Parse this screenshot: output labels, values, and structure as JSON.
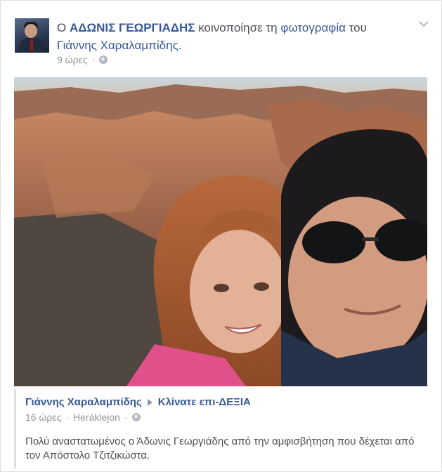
{
  "post": {
    "prefix": "Ο",
    "author": "ΑΔΩΝΙΣ ΓΕΩΡΓΙΑΔΗΣ",
    "action": "κοινοποίησε τη",
    "object": "φωτογραφία",
    "connector": "του",
    "owner": "Γιάννης Χαραλαμπίδης",
    "owner_suffix": ".",
    "time": "9 ώρες",
    "separator": "·",
    "privacy_icon": "globe-icon",
    "menu_icon": "chevron-down-icon"
  },
  "shared": {
    "author": "Γιάννης Χαραλαμπίδης",
    "arrow_icon": "triangle-right-icon",
    "target": "Κλίνατε επι-ΔΕΞΙΑ",
    "time": "16 ώρες",
    "separator": "·",
    "location": "Heráklejon",
    "privacy_icon": "globe-icon",
    "caption": "Πολύ αναστατωμένος ο Άδωνις Γεωργιάδης από την αμφισβήτηση που δέχεται από τον Απόστολο Τζιτζικώστα."
  },
  "colors": {
    "link": "#365899",
    "meta": "#90949c",
    "text": "#4b4f56",
    "border": "#dddfe2"
  }
}
